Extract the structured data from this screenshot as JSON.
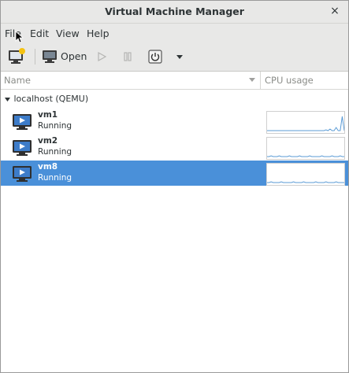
{
  "window": {
    "title": "Virtual Machine Manager",
    "close_glyph": "×"
  },
  "menubar": {
    "items": [
      "File",
      "Edit",
      "View",
      "Help"
    ]
  },
  "toolbar": {
    "new_vm_icon": "new-vm-icon",
    "open_label": "Open",
    "open_icon": "monitor-icon",
    "run_icon": "play-icon",
    "pause_icon": "pause-icon",
    "shutdown_icon": "power-icon",
    "menu_icon": "chevron-down-icon"
  },
  "columns": {
    "name": "Name",
    "cpu": "CPU usage"
  },
  "group": {
    "label": "localhost (QEMU)",
    "expander_icon": "triangle-down-icon"
  },
  "vms": [
    {
      "name": "vm1",
      "status": "Running",
      "selected": false,
      "cpu": [
        0,
        0,
        0,
        0,
        0,
        0,
        0,
        0,
        0,
        0,
        0,
        0,
        0,
        0,
        0,
        0,
        0,
        0,
        0,
        0,
        0,
        0,
        0,
        0,
        0,
        0,
        0,
        0,
        0,
        0.05,
        0,
        0.1,
        0,
        0,
        0.2,
        0,
        0,
        0.9,
        0
      ]
    },
    {
      "name": "vm2",
      "status": "Running",
      "selected": false,
      "cpu": [
        0,
        0,
        0.05,
        0,
        0,
        0,
        0.05,
        0,
        0,
        0,
        0,
        0.05,
        0,
        0,
        0,
        0,
        0.05,
        0,
        0,
        0,
        0,
        0.05,
        0,
        0,
        0,
        0,
        0,
        0.05,
        0,
        0,
        0,
        0,
        0.05,
        0,
        0,
        0,
        0.05,
        0,
        0
      ]
    },
    {
      "name": "vm8",
      "status": "Running",
      "selected": true,
      "cpu": [
        0,
        0,
        0.05,
        0,
        0,
        0,
        0,
        0.05,
        0,
        0,
        0,
        0,
        0,
        0.05,
        0,
        0,
        0,
        0,
        0.05,
        0,
        0,
        0,
        0,
        0,
        0.05,
        0,
        0,
        0,
        0,
        0.05,
        0,
        0,
        0,
        0,
        0.05,
        0,
        0,
        0,
        0
      ]
    }
  ],
  "colors": {
    "selection": "#4a90d9",
    "sparkline": "#5b9bd5",
    "chrome": "#e8e8e7"
  }
}
